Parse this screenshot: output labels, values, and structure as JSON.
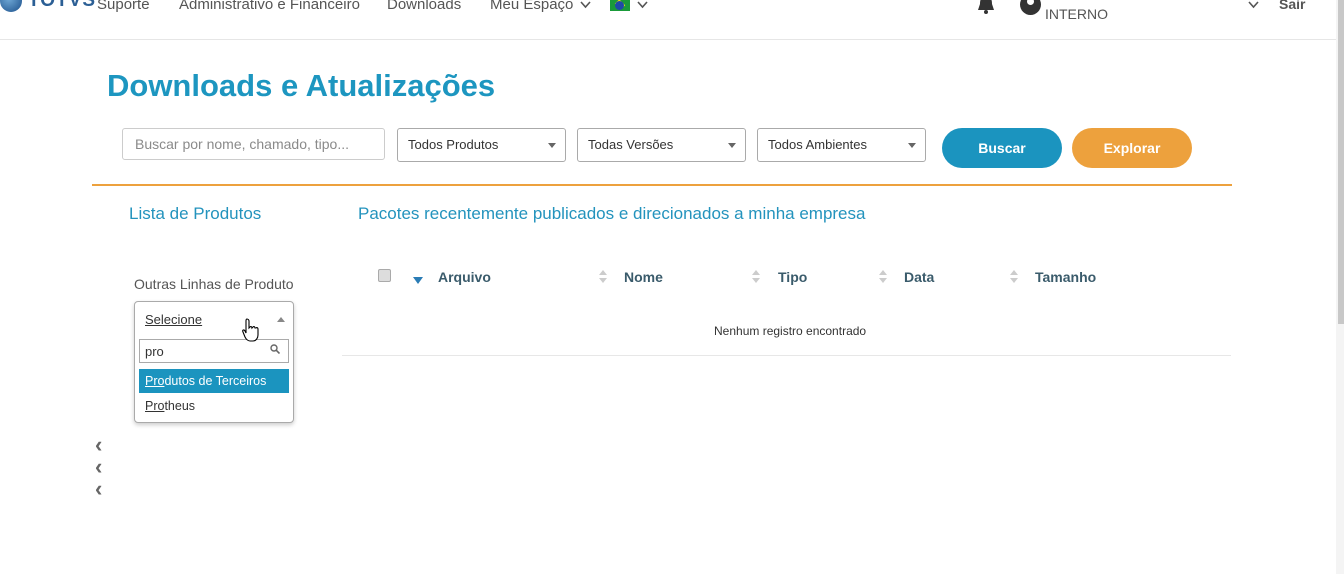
{
  "nav": {
    "logo": "TOTVS",
    "items": [
      "Suporte",
      "Administrativo e Financeiro",
      "Downloads",
      "Meu Espaço"
    ],
    "user_label": "INTERNO",
    "logout": "Sair",
    "icons": [
      "bell-icon",
      "user-icon",
      "flag-brazil-icon",
      "chevron-down-icon"
    ]
  },
  "page": {
    "title": "Downloads e Atualizações"
  },
  "search": {
    "placeholder": "Buscar por nome, chamado, tipo...",
    "products_select": "Todos Produtos",
    "versions_select": "Todas Versões",
    "environments_select": "Todos Ambientes",
    "search_button": "Buscar",
    "explore_button": "Explorar"
  },
  "left_panel": {
    "title": "Lista de Produtos",
    "other_lines_label": "Outras Linhas de Produto",
    "dropdown": {
      "selected": "Selecione",
      "search_value": "pro",
      "options": [
        {
          "match": "Pro",
          "rest": "dutos de Terceiros",
          "active": true
        },
        {
          "match": "Pro",
          "rest": "theus",
          "active": false
        }
      ]
    }
  },
  "main": {
    "title": "Pacotes recentemente publicados e direcionados a minha empresa",
    "columns": [
      "Arquivo",
      "Nome",
      "Tipo",
      "Data",
      "Tamanho"
    ],
    "empty_message": "Nenhum registro encontrado"
  },
  "colors": {
    "accent_blue": "#1b94bf",
    "accent_orange": "#eda13d",
    "title_blue": "#1d96c0"
  }
}
